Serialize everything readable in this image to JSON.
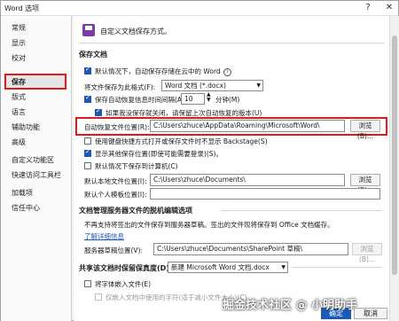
{
  "window": {
    "title": "Word 选项",
    "help_btn": "?",
    "close_btn": "✕"
  },
  "sidebar": {
    "items": [
      "常规",
      "显示",
      "校对",
      "保存",
      "版式",
      "语言",
      "辅助功能",
      "高级",
      "自定义功能区",
      "快速访问工具栏",
      "加载项",
      "信任中心"
    ],
    "selected_index": 3
  },
  "header": {
    "text": "自定义文档保存方式。"
  },
  "save_docs": {
    "section_title": "保存文档",
    "onedrive_default": "默认情况下，自动保存存储在云中的 Word",
    "format_label": "将文件保存为此格式(F):",
    "format_value": "Word 文档 (*.docx)",
    "autorecover_label": "保存自动恢复信息时间间隔(A)",
    "autorecover_minutes": "10",
    "minutes_unit": "分钟(M)",
    "keep_last_label": "如果我没保存就关闭，请保留上次自动恢复的版本(U)",
    "recover_loc_label": "自动恢复文件位置(R):",
    "recover_loc_value": "C:\\Users\\zhuce\\AppData\\Roaming\\Microsoft\\Word\\",
    "browse_label": "浏览(B)...",
    "no_backstage_label": "使用键盘快捷方式打开或保存文件时不显示 Backstage(S)",
    "show_other_locations": "显示其他保存位置(即使可能需要登录)(S)。",
    "save_to_computer": "默认情况下保存到计算机(C)",
    "local_loc_label": "默认本地文件位置(I):",
    "local_loc_value": "C:\\Users\\zhuce\\Documents\\",
    "browse2_label": "浏览(B)...",
    "personal_tpl_label": "默认个人模板位置(I):"
  },
  "server": {
    "section_title": "文档管理服务器文件的脱机编辑选项",
    "desc": "不再支持将签出的文件保存到服务器草稿。签出的文件现将保存到 Office 文档缓存。",
    "learn_more": "了解详细信息",
    "drafts_label": "服务器草稿位置(V):",
    "drafts_value": "C:\\Users\\zhuce\\Documents\\SharePoint 草稿\\",
    "browse3_label": "浏览(B)..."
  },
  "fidelity": {
    "label": "共享该文档时保留保真度(D):",
    "doc_value": "新建 Microsoft Word 文档.docx",
    "embed_fonts": "将字体嵌入文件(E)",
    "only_used_chars": "仅嵌入文档中使用的字符(适于减小文件大小)(C)"
  },
  "footer": {
    "ok": "确定",
    "cancel": "取消"
  },
  "watermark": "掘金技术社区 @ 小明助手",
  "colors": {
    "accent": "#1a5bb8",
    "highlight": "#e0191b",
    "icon": "#7a3aa8"
  }
}
